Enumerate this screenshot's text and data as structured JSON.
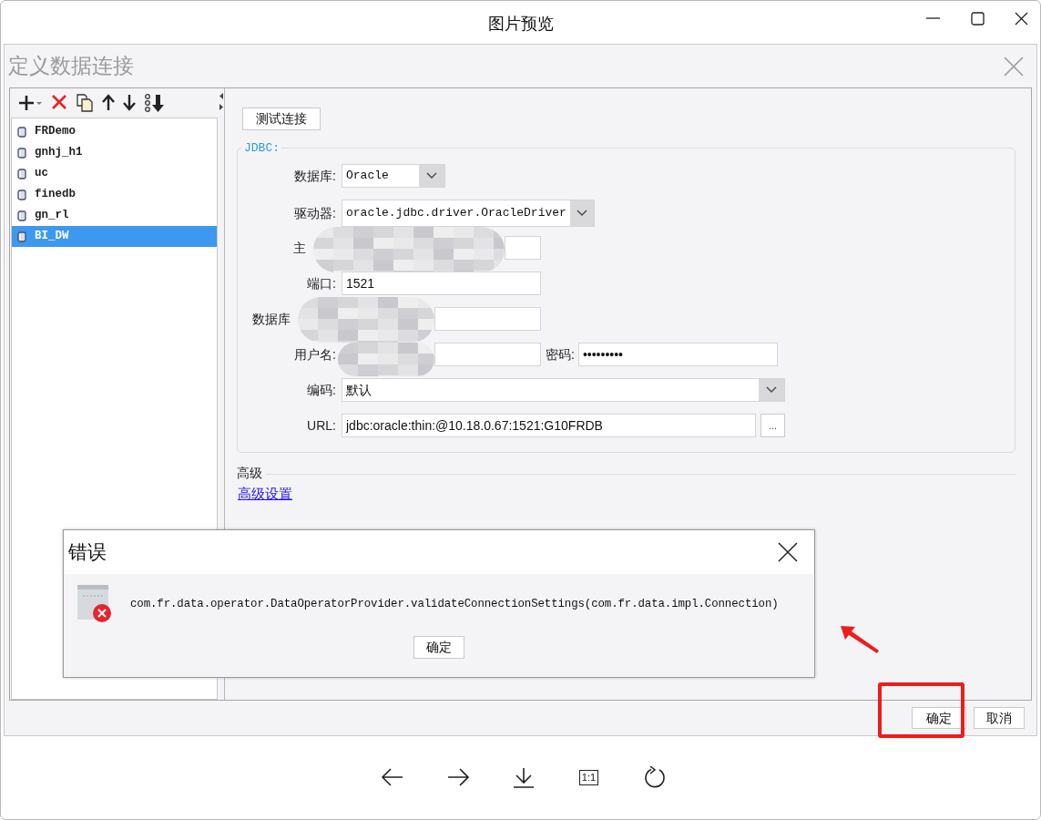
{
  "viewer": {
    "title": "图片预览",
    "actual_size": "1:1"
  },
  "dialog": {
    "title": "定义数据连接",
    "connections": [
      {
        "name": "FRDemo",
        "selected": false
      },
      {
        "name": "gnhj_h1",
        "selected": false
      },
      {
        "name": "uc",
        "selected": false
      },
      {
        "name": "finedb",
        "selected": false
      },
      {
        "name": "gn_rl",
        "selected": false
      },
      {
        "name": "BI_DW",
        "selected": true
      }
    ],
    "test_button": "测试连接",
    "jdbc": {
      "legend": "JDBC:",
      "fields": [
        {
          "kind": "short-select",
          "label": "数据库:",
          "value": "Oracle",
          "obscured": false
        },
        {
          "kind": "select",
          "label": "驱动器:",
          "value": "oracle.jdbc.driver.OracleDriver",
          "obscured": false
        },
        {
          "kind": "input",
          "label": "主",
          "obscured": true
        },
        {
          "kind": "input",
          "label": "端口:",
          "value": "1521",
          "obscured": false
        },
        {
          "kind": "input",
          "label": "数据库",
          "obscured": true
        },
        {
          "kind": "pair",
          "label": "用户名:",
          "label_2": "密码:",
          "value_2": "•••••••••",
          "obscured": true
        },
        {
          "kind": "wide-select",
          "label": "编码:",
          "value": "默认",
          "obscured": false
        },
        {
          "kind": "browse",
          "label": "URL:",
          "value": "jdbc:oracle:thin:@10.18.0.67:1521:G10FRDB",
          "button": "...",
          "obscured": false
        }
      ]
    },
    "advanced": {
      "heading": "高级",
      "link": "高级设置"
    },
    "buttons": [
      "确定",
      "取消"
    ]
  },
  "error_dialog": {
    "title": "错误",
    "message": "com.fr.data.operator.DataOperatorProvider.validateConnectionSettings(com.fr.data.impl.Connection)",
    "button": "确定"
  }
}
